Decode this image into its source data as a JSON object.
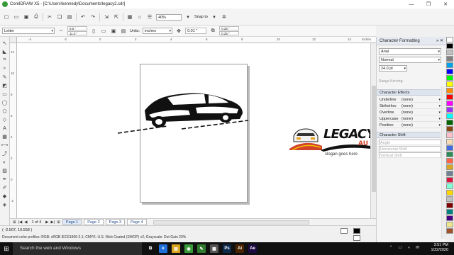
{
  "window": {
    "title": "CorelDRAW X5 - [C:\\Users\\kennedy\\Documents\\legacy2.cdr]"
  },
  "toolbar": {
    "zoom_value": "40%",
    "snap_to_label": "Snap to",
    "icons": [
      "new-icon",
      "open-icon",
      "save-icon",
      "print-icon",
      "cut-icon",
      "copy-icon",
      "paste-icon",
      "undo-icon",
      "redo-icon",
      "import-icon",
      "export-icon",
      "app-launcher-icon",
      "welcome-icon",
      "options-icon"
    ]
  },
  "propbar": {
    "paper_type": "Letter",
    "width": "8.5 \"",
    "height": "11.0 \"",
    "units_label": "Units:",
    "units_value": "inches",
    "nudge": "0.01 \"",
    "dup_x": "0.25 \"",
    "dup_y": "0.25 \""
  },
  "ruler": {
    "h_ticks": [
      "-4",
      "-2",
      "0",
      "2",
      "4",
      "6",
      "8",
      "10",
      "12",
      "14"
    ],
    "h_unit": "inches",
    "v_ticks": [
      "12",
      "10",
      "8",
      "6",
      "4",
      "2",
      "0",
      "-2"
    ]
  },
  "artwork": {
    "brand_word": "LEGACYH",
    "brand_sub": "AU",
    "slogan": "slogan goes here"
  },
  "pages": {
    "count_text": "1 of 4",
    "tabs": [
      "Page 1",
      "Page 2",
      "Page 3",
      "Page 4"
    ],
    "active_index": 0
  },
  "status": {
    "coords": "( -2.507, 10.558 )",
    "profiles": "Document color profiles: RGB: sRGB IEC61966-2.1; CMYK: U.S. Web Coated (SWOP) v2; Grayscale: Dot Gain 20%"
  },
  "docker": {
    "title": "Character Formatting",
    "font": "Arial",
    "style": "Normal",
    "size": "24.0 pt",
    "range_kerning_label": "Range Kerning:",
    "effects_section": "Character Effects",
    "effects": [
      {
        "label": "Underline",
        "value": "(none)"
      },
      {
        "label": "Strikethru",
        "value": "(none)"
      },
      {
        "label": "Overline",
        "value": "(none)"
      },
      {
        "label": "Uppercase",
        "value": "(none)"
      },
      {
        "label": "Position",
        "value": "(none)"
      }
    ],
    "shift_section": "Character Shift",
    "shifts": [
      "Angle",
      "Horizontal Shift",
      "Vertical Shift"
    ]
  },
  "palette": {
    "colors": [
      "#ffffff",
      "#000000",
      "#bfbfbf",
      "#808080",
      "#00a2e8",
      "#0000ff",
      "#00ff00",
      "#ffff00",
      "#ff8c00",
      "#ff0000",
      "#ff00ff",
      "#9b30ff",
      "#00ffff",
      "#006400",
      "#8b4513",
      "#ffc0cb",
      "#f5deb3",
      "#4169e1",
      "#2e8b57",
      "#ff6347",
      "#daa520",
      "#708090",
      "#dc143c",
      "#7fffd4",
      "#ffd700",
      "#c0c0c0",
      "#800000",
      "#008080",
      "#4b0082",
      "#f0e68c",
      "#a0522d"
    ]
  },
  "taskbar": {
    "search_placeholder": "Search the web and Windows",
    "apps": [
      {
        "name": "task-view",
        "label": "⧉",
        "color": "#101010"
      },
      {
        "name": "edge",
        "label": "e",
        "color": "#1e6fd9"
      },
      {
        "name": "explorer",
        "label": "▤",
        "color": "#d9a520"
      },
      {
        "name": "chrome",
        "label": "◉",
        "color": "#3a9a3a"
      },
      {
        "name": "coreldraw",
        "label": "✎",
        "color": "#2f7a2f"
      },
      {
        "name": "store",
        "label": "▦",
        "color": "#555"
      },
      {
        "name": "photoshop",
        "label": "Ps",
        "color": "#0c2a4a"
      },
      {
        "name": "illustrator",
        "label": "Ai",
        "color": "#4a2300"
      },
      {
        "name": "after-effects",
        "label": "Ae",
        "color": "#1c0a40"
      }
    ],
    "time": "3:51 PM",
    "date": "1/22/2020"
  }
}
